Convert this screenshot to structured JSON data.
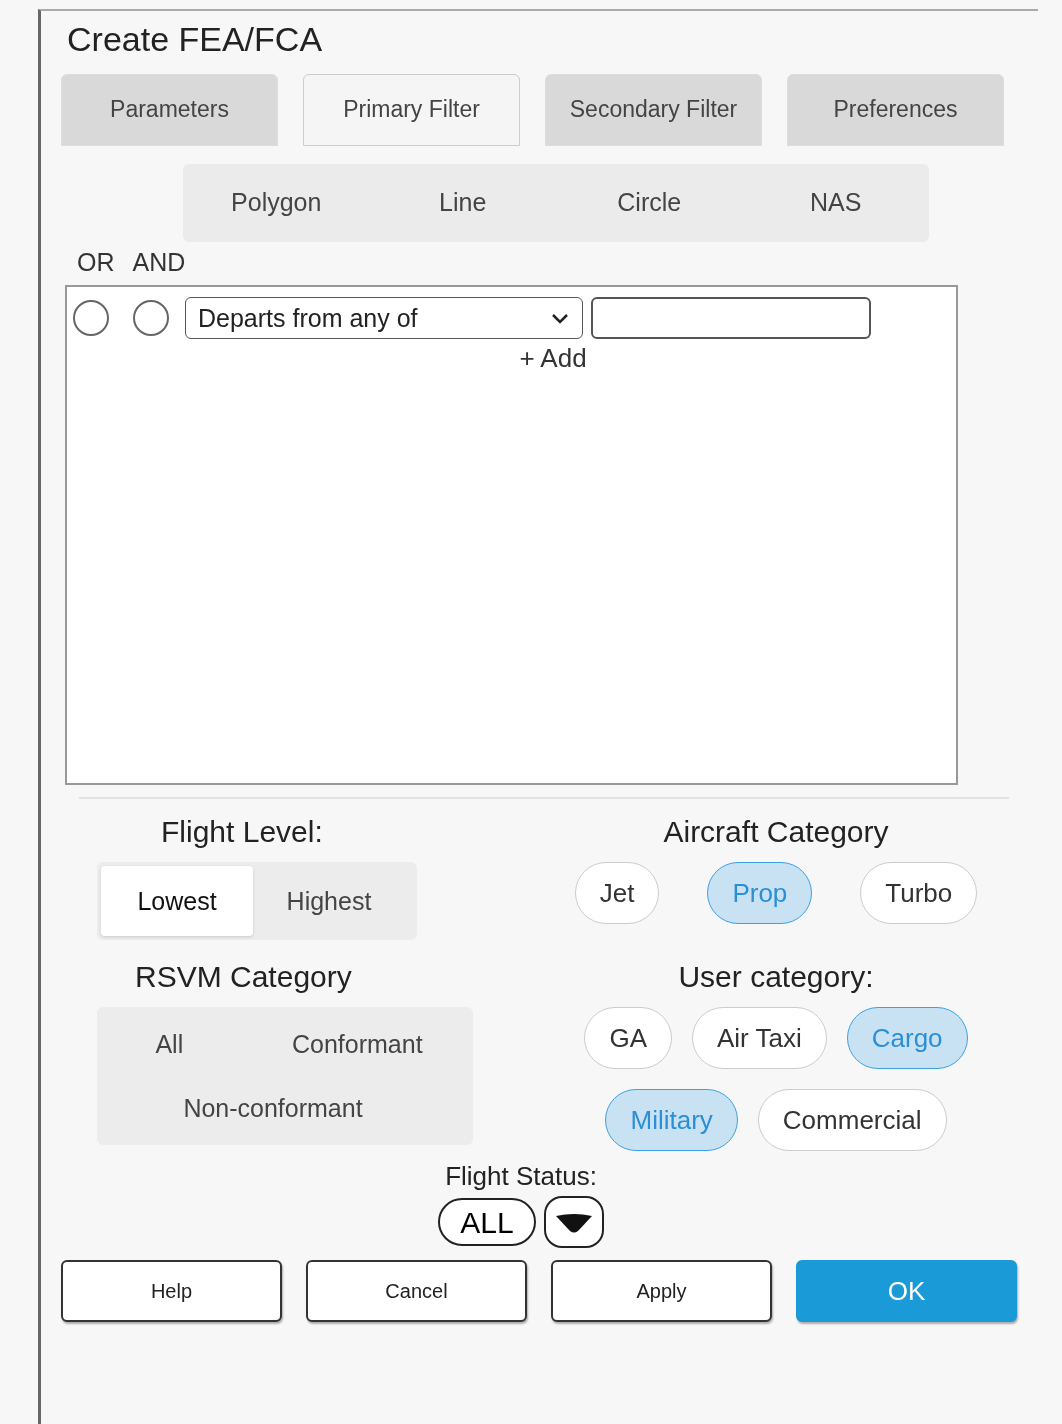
{
  "window": {
    "title": "Create FEA/FCA"
  },
  "tabs": [
    {
      "label": "Parameters",
      "selected": false
    },
    {
      "label": "Primary Filter",
      "selected": true
    },
    {
      "label": "Secondary Filter",
      "selected": false
    },
    {
      "label": "Preferences",
      "selected": false
    }
  ],
  "shapes": [
    {
      "label": "Polygon",
      "selected": false
    },
    {
      "label": "Line",
      "selected": false
    },
    {
      "label": "Circle",
      "selected": false
    },
    {
      "label": "NAS",
      "selected": false
    }
  ],
  "logic_labels": [
    "OR",
    "AND"
  ],
  "filter_rows": [
    {
      "or_checked": false,
      "and_checked": false,
      "condition": "Departs from any of",
      "value": ""
    }
  ],
  "add_link": "+ Add",
  "flight_level": {
    "label": "Flight Level:",
    "options": [
      {
        "label": "Lowest",
        "selected": true
      },
      {
        "label": "Highest",
        "selected": false
      }
    ]
  },
  "aircraft_category": {
    "label": "Aircraft Category",
    "options": [
      {
        "label": "Jet",
        "selected": false
      },
      {
        "label": "Prop",
        "selected": true
      },
      {
        "label": "Turbo",
        "selected": false
      }
    ]
  },
  "rsvm_category": {
    "label": "RSVM Category",
    "options": [
      {
        "label": "All",
        "selected": false
      },
      {
        "label": "Conformant",
        "selected": false
      },
      {
        "label": "Non-conformant",
        "selected": false
      }
    ]
  },
  "user_category": {
    "label": "User category:",
    "options": [
      {
        "label": "GA",
        "selected": false
      },
      {
        "label": "Air Taxi",
        "selected": false
      },
      {
        "label": "Cargo",
        "selected": true
      },
      {
        "label": "Military",
        "selected": true
      },
      {
        "label": "Commercial",
        "selected": false
      }
    ]
  },
  "flight_status": {
    "label": "Flight Status:",
    "value": "ALL"
  },
  "buttons": [
    {
      "label": "Help",
      "kind": "plain"
    },
    {
      "label": "Cancel",
      "kind": "plain"
    },
    {
      "label": "Apply",
      "kind": "plain"
    },
    {
      "label": "OK",
      "kind": "primary"
    }
  ]
}
